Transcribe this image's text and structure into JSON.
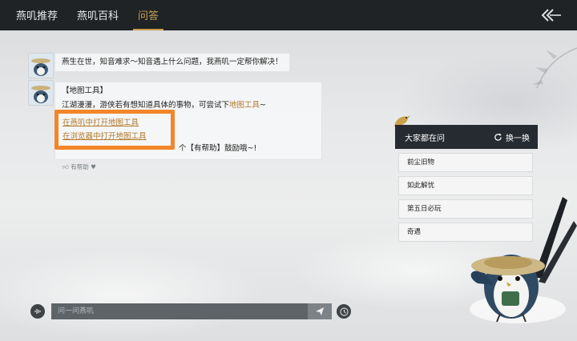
{
  "tabs": [
    {
      "label": "燕叽推荐",
      "active": false
    },
    {
      "label": "燕叽百科",
      "active": false
    },
    {
      "label": "问答",
      "active": true
    }
  ],
  "chat": {
    "message1": "燕生在世，知音难求～知音遇上什么问题，我燕叽一定帮你解决！",
    "message2": {
      "title": "【地图工具】",
      "line_prefix": "江湖漫漫，游侠若有想知道具体的事物，可尝试下",
      "line_link": "地图工具",
      "line_suffix": "~",
      "link1": "在燕叽中打开地图工具",
      "link2": "在浏览器中打开地图工具",
      "footer": "个【有帮助】鼓励哦~!"
    },
    "helpful_label": "有帮助"
  },
  "popular": {
    "header": "大家都在问",
    "refresh_label": "换一换",
    "items": [
      "前尘旧物",
      "如此解忧",
      "第五日必玩",
      "奇遇"
    ]
  },
  "input": {
    "placeholder": "问一问燕叽"
  },
  "colors": {
    "accent": "#c8a052",
    "link": "#b07a2a",
    "highlight_box": "#f2862a",
    "topbar": "#1f2326"
  },
  "icons": {
    "back": "double-chevron-left-icon",
    "refresh": "refresh-icon",
    "voice": "voice-wave-icon",
    "send": "send-plane-icon",
    "history": "clock-icon",
    "thumb": "thumbs-up-icon"
  }
}
